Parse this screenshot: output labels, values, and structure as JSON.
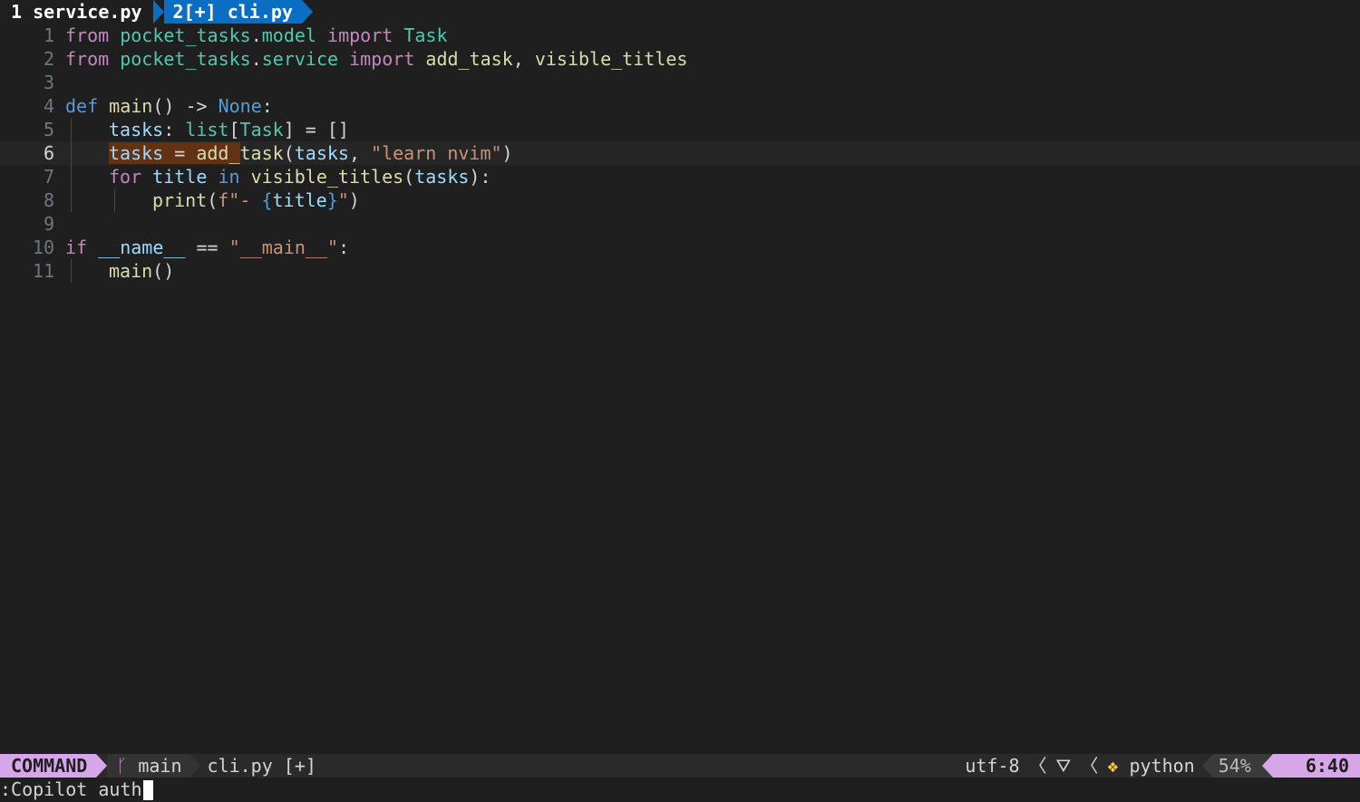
{
  "tabs": [
    {
      "label": "1 service.py",
      "active": false
    },
    {
      "label": "2[+] cli.py",
      "active": true
    }
  ],
  "code_lines": [
    {
      "n": "1"
    },
    {
      "n": "2"
    },
    {
      "n": "3"
    },
    {
      "n": "4"
    },
    {
      "n": "5"
    },
    {
      "n": "6"
    },
    {
      "n": "7"
    },
    {
      "n": "8"
    },
    {
      "n": "9"
    },
    {
      "n": "10"
    },
    {
      "n": "11"
    }
  ],
  "code": {
    "l1": [
      "from",
      " ",
      "pocket_tasks",
      ".",
      "model",
      " ",
      "import",
      " ",
      "Task"
    ],
    "l2": [
      "from",
      " ",
      "pocket_tasks",
      ".",
      "service",
      " ",
      "import",
      " ",
      "add_task",
      ", ",
      "visible_titles"
    ],
    "l4": [
      "def",
      " ",
      "main",
      "() -> ",
      "None",
      ":"
    ],
    "l5": [
      "tasks",
      ": ",
      "list",
      "[",
      "Task",
      "] = []"
    ],
    "l6": [
      "tasks",
      " = ",
      "add_",
      "task",
      "(",
      "tasks",
      ", ",
      "\"learn nvim\"",
      ")"
    ],
    "l7": [
      "for",
      " ",
      "title",
      " ",
      "in",
      " ",
      "visible_titles",
      "(",
      "tasks",
      "):"
    ],
    "l8": [
      "print",
      "(",
      "f\"- ",
      "{",
      "title",
      "}",
      "\"",
      ")"
    ],
    "l10": [
      "if",
      " ",
      "__name__",
      " == ",
      "\"__main__\"",
      ":"
    ],
    "l11": [
      "main",
      "()"
    ]
  },
  "status": {
    "mode": "COMMAND",
    "branch": "main",
    "file": "cli.py [+]",
    "encoding": "utf-8",
    "os_icon": "linux-icon",
    "filetype": "python",
    "percent": "54%",
    "position": "6:40"
  },
  "cmdline": {
    "text": ":Copilot auth"
  }
}
